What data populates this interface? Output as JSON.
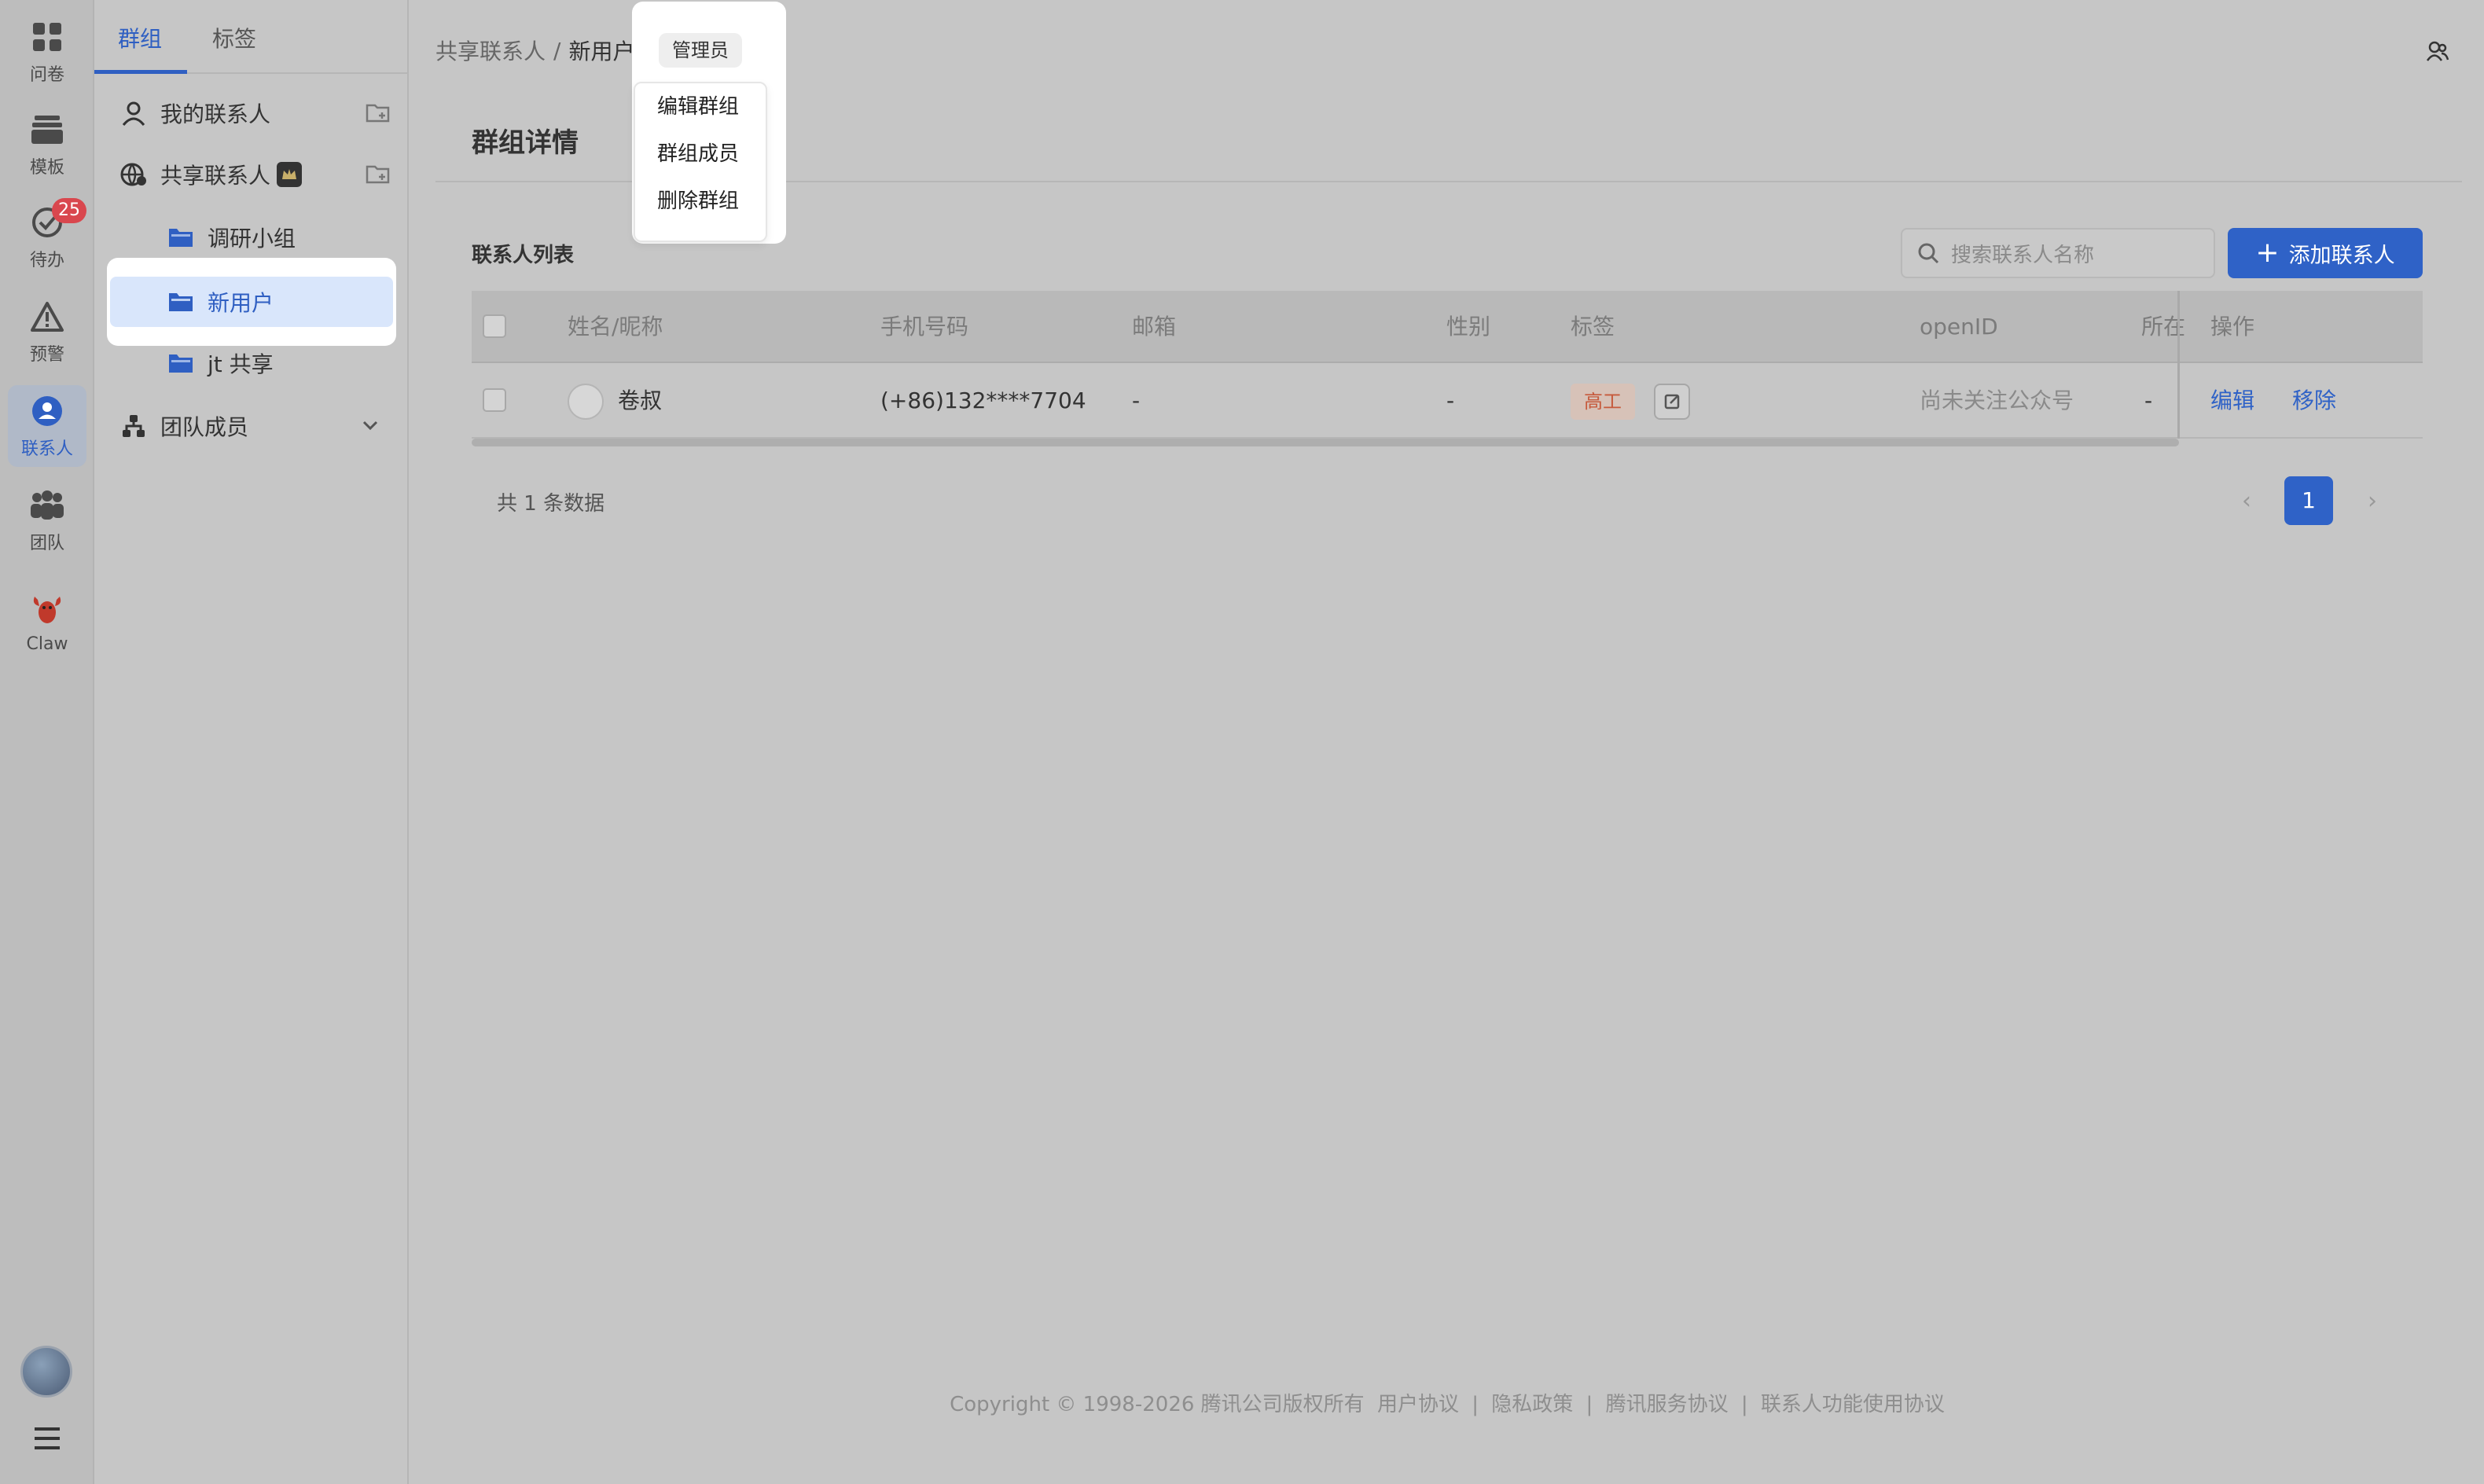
{
  "rail": {
    "items": [
      {
        "label": "问卷",
        "icon": "grid-icon"
      },
      {
        "label": "模板",
        "icon": "archive-icon"
      },
      {
        "label": "待办",
        "icon": "check-circle-icon",
        "badge": "25"
      },
      {
        "label": "预警",
        "icon": "warning-icon"
      },
      {
        "label": "联系人",
        "icon": "contact-icon",
        "active": true
      },
      {
        "label": "团队",
        "icon": "team-icon"
      },
      {
        "label": "Claw",
        "icon": "lobster-icon"
      }
    ]
  },
  "sidebar": {
    "tabs": [
      {
        "label": "群组",
        "active": true
      },
      {
        "label": "标签"
      }
    ],
    "items": [
      {
        "label": "我的联系人"
      },
      {
        "label": "共享联系人"
      },
      {
        "label": "调研小组"
      },
      {
        "label": "新用户",
        "selected": true
      },
      {
        "label": "jt 共享"
      },
      {
        "label": "团队成员"
      }
    ]
  },
  "breadcrumb": {
    "parent": "共享联系人",
    "separator": "/",
    "current": "新用户"
  },
  "role_chip": "管理员",
  "group_menu": [
    "编辑群组",
    "群组成员",
    "删除群组"
  ],
  "page_title": "群组详情",
  "section_label": "联系人列表",
  "search": {
    "placeholder": "搜索联系人名称"
  },
  "add_button": {
    "label": "添加联系人"
  },
  "table": {
    "columns": [
      "姓名/昵称",
      "手机号码",
      "邮箱",
      "性别",
      "标签",
      "openID",
      "所在",
      "操作"
    ],
    "rows": [
      {
        "name": "卷叔",
        "phone": "(+86)132****7704",
        "email": "-",
        "gender": "-",
        "tag": "高工",
        "openid": "尚未关注公众号",
        "location": "-",
        "actions": [
          "编辑",
          "移除"
        ]
      }
    ]
  },
  "pagination": {
    "total_text": "共 1 条数据",
    "current": "1"
  },
  "footer": {
    "copyright": "Copyright © 1998-2026 腾讯公司版权所有",
    "links": [
      "用户协议",
      "隐私政策",
      "腾讯服务协议",
      "联系人功能使用协议"
    ],
    "separator": "|"
  },
  "colors": {
    "accent": "#2f62c7",
    "badge": "#d9474e",
    "tag_text": "#c65a3c"
  }
}
